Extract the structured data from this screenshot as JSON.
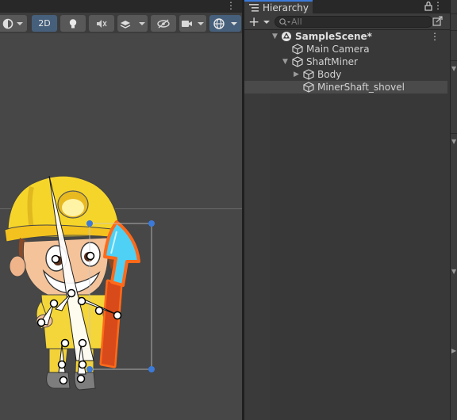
{
  "scene_toolbar": {
    "mode_2d_label": "2D"
  },
  "hierarchy": {
    "tab_title": "Hierarchy",
    "search_placeholder": "All",
    "add_label": "+",
    "menu_glyph": "⋮",
    "items": [
      {
        "label": "SampleScene*",
        "icon": "unity-scene-icon",
        "expanded": true,
        "depth": 0,
        "selected": false
      },
      {
        "label": "Main Camera",
        "icon": "gameobject-cube-icon",
        "depth": 1,
        "selected": false
      },
      {
        "label": "ShaftMiner",
        "icon": "gameobject-cube-icon",
        "expanded": true,
        "depth": 1,
        "selected": false
      },
      {
        "label": "Body",
        "icon": "gameobject-cube-icon",
        "expanded": false,
        "depth": 2,
        "selected": false
      },
      {
        "label": "MinerShaft_shovel",
        "icon": "gameobject-cube-icon",
        "depth": 2,
        "selected": true
      }
    ]
  },
  "colors": {
    "accent": "#3b7ad9",
    "active_toolbar": "#46607c",
    "selection_outline": "#ff6a1a",
    "handle_blue": "#3b7ad9"
  }
}
